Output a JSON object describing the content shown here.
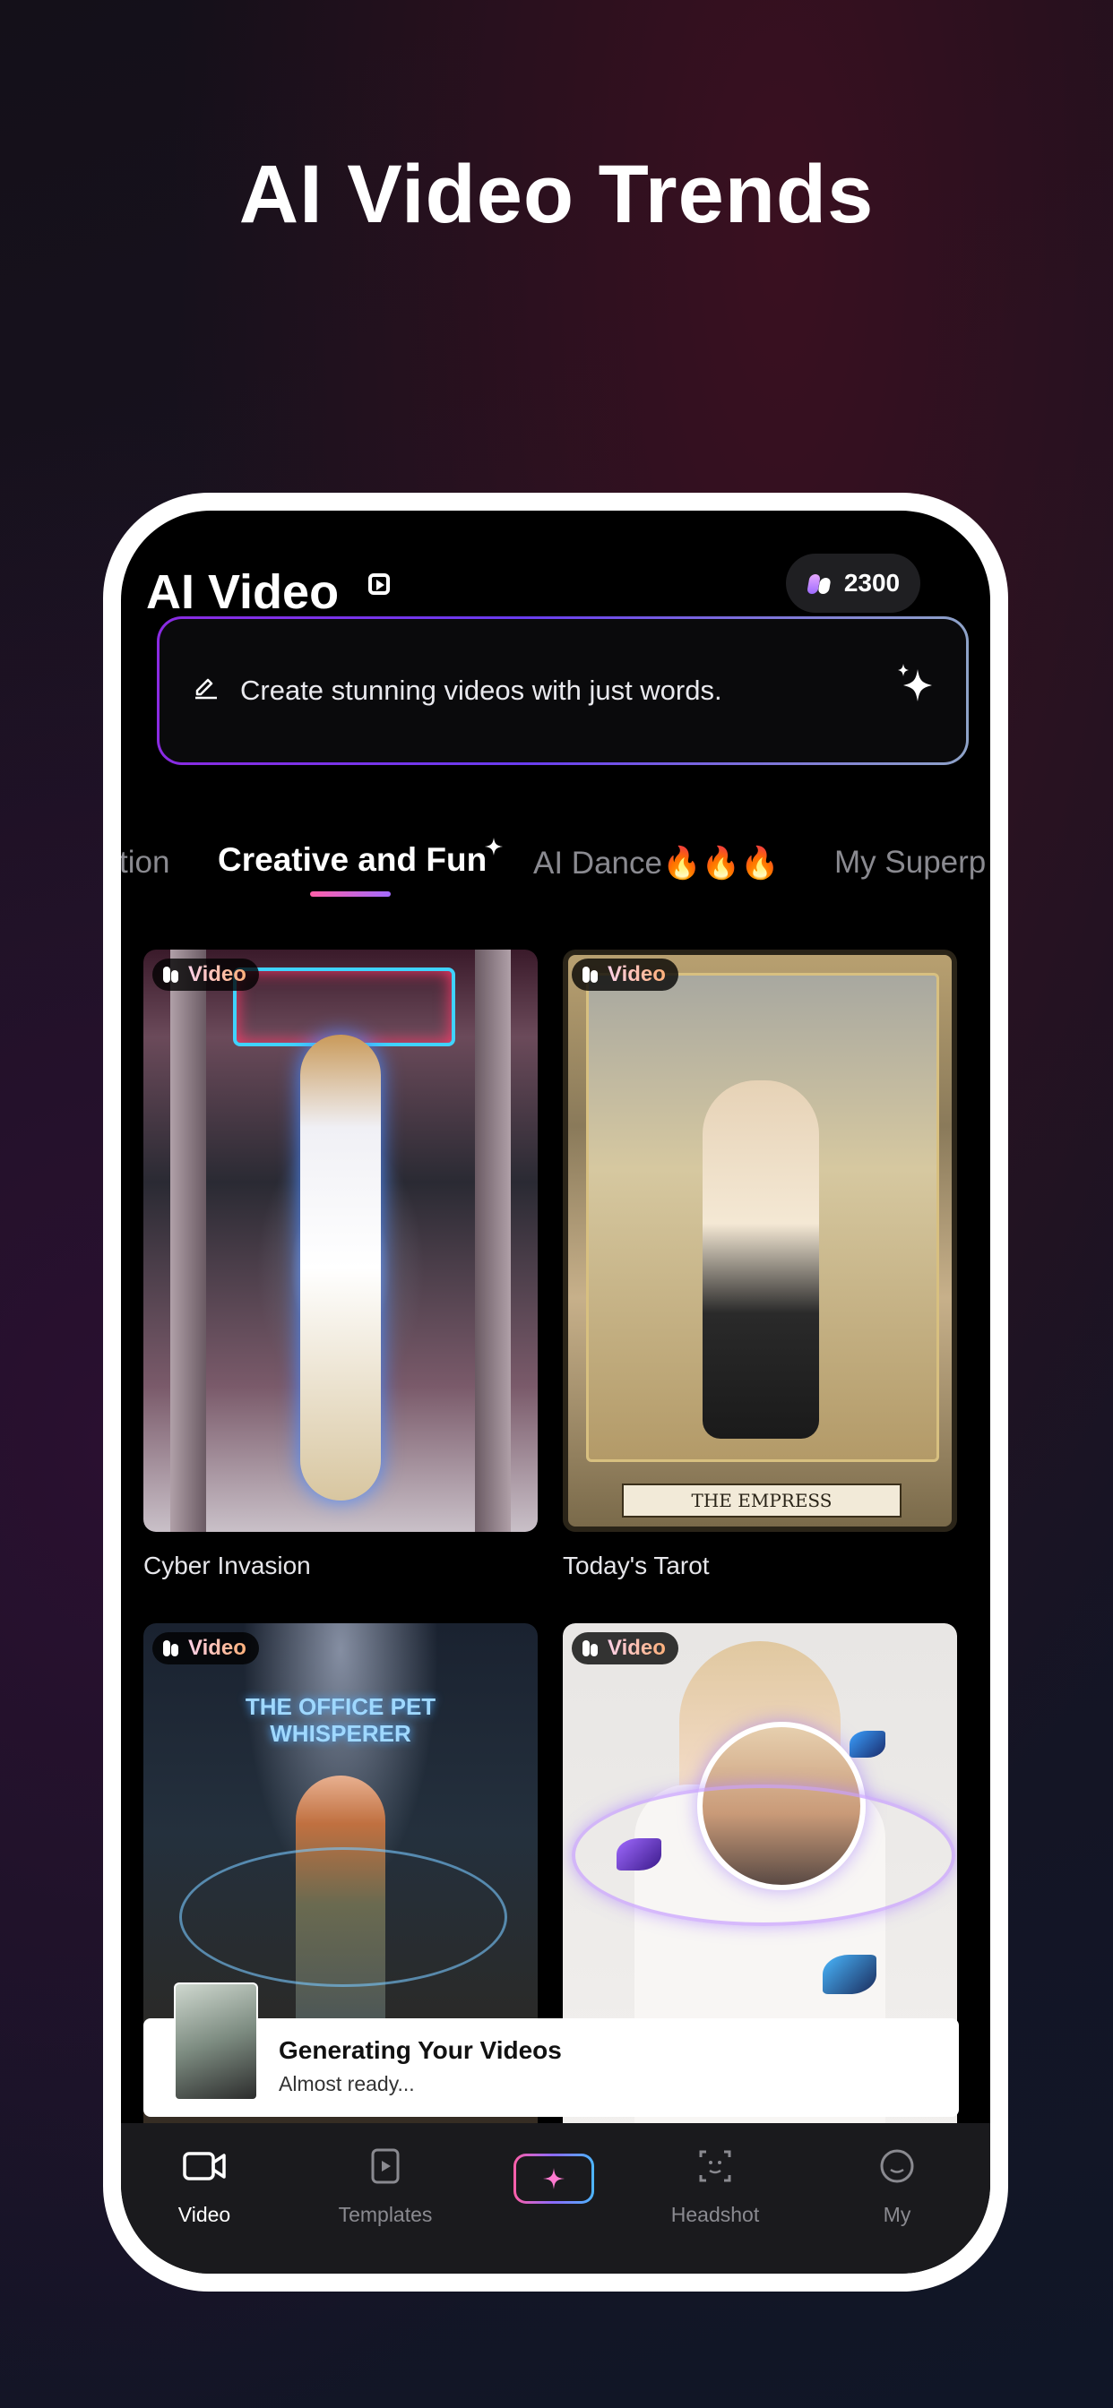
{
  "headline": "AI Video Trends",
  "app": {
    "title": "AI Video",
    "credits": "2300"
  },
  "prompt": {
    "placeholder": "Create stunning videos with just words."
  },
  "tabs": [
    {
      "label": "tion",
      "active": false
    },
    {
      "label": "Creative and Fun",
      "active": true
    },
    {
      "label": "AI Dance🔥🔥🔥",
      "active": false
    },
    {
      "label": "My Superp",
      "active": false
    }
  ],
  "cards": [
    {
      "badge": "Video",
      "title": "Cyber Invasion"
    },
    {
      "badge": "Video",
      "title": "Today's Tarot",
      "caption": "THE EMPRESS"
    },
    {
      "badge": "Video",
      "title": "",
      "caption": "THE OFFICE PET\nWHISPERER"
    },
    {
      "badge": "Video",
      "title": ""
    }
  ],
  "toast": {
    "title": "Generating Your Videos",
    "subtitle": "Almost ready..."
  },
  "nav": [
    {
      "label": "Video",
      "icon": "video-camera-icon",
      "active": true
    },
    {
      "label": "Templates",
      "icon": "templates-icon",
      "active": false
    },
    {
      "label": "",
      "icon": "sparkle-create-icon",
      "active": false
    },
    {
      "label": "Headshot",
      "icon": "face-scan-icon",
      "active": false
    },
    {
      "label": "My",
      "icon": "smiley-icon",
      "active": false
    }
  ],
  "colors": {
    "accent_pink": "#ff5fa8",
    "accent_purple": "#8a2be2",
    "accent_blue": "#4db6ff"
  }
}
